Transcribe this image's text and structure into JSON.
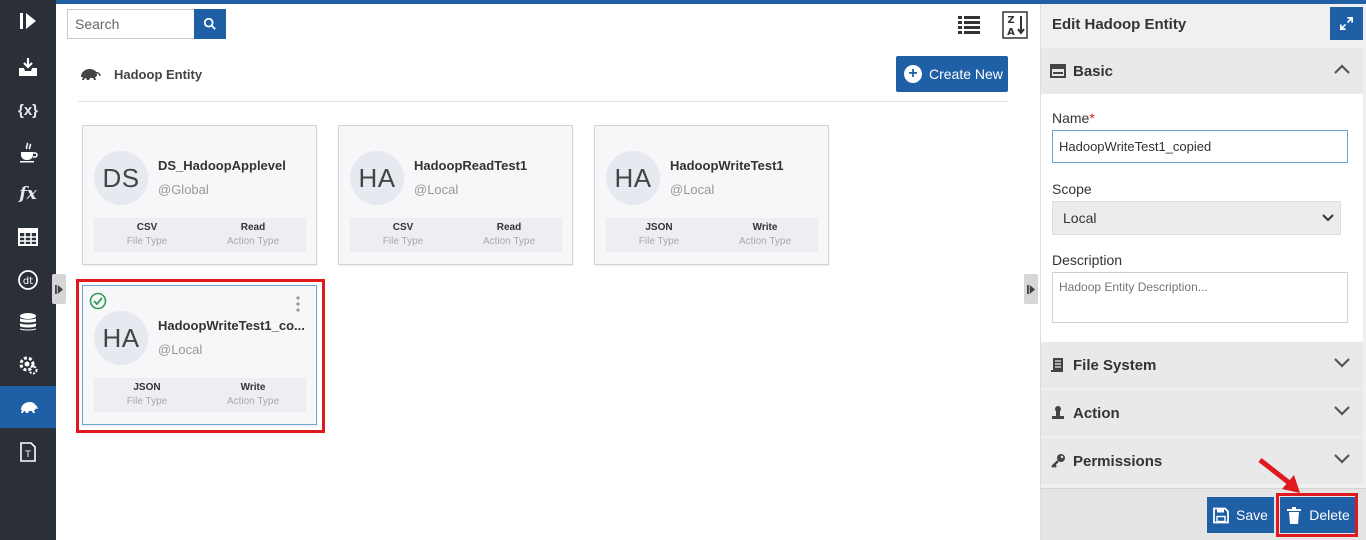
{
  "theme": {
    "accent": "#1f5fa6",
    "rail": "#2b2f38",
    "highlight": "#e0191f"
  },
  "rail": {
    "items": [
      {
        "icon": "play-icon"
      },
      {
        "icon": "download-tray-icon"
      },
      {
        "icon": "variables-icon",
        "text": "{x}"
      },
      {
        "icon": "java-cup-icon"
      },
      {
        "icon": "function-icon",
        "text": "fx"
      },
      {
        "icon": "table-icon"
      },
      {
        "icon": "dt-icon"
      },
      {
        "icon": "database-icon"
      },
      {
        "icon": "gear-settings-icon"
      },
      {
        "icon": "hadoop-elephant-icon",
        "active": true
      },
      {
        "icon": "text-file-icon"
      }
    ]
  },
  "toolbar": {
    "search_placeholder": "Search"
  },
  "page": {
    "title": "Hadoop Entity",
    "create_label": "Create New"
  },
  "cards": [
    {
      "initials": "DS",
      "name": "DS_HadoopApplevel",
      "scope": "@Global",
      "file_type": "CSV",
      "file_type_label": "File Type",
      "action_type": "Read",
      "action_type_label": "Action Type"
    },
    {
      "initials": "HA",
      "name": "HadoopReadTest1",
      "scope": "@Local",
      "file_type": "CSV",
      "file_type_label": "File Type",
      "action_type": "Read",
      "action_type_label": "Action Type"
    },
    {
      "initials": "HA",
      "name": "HadoopWriteTest1",
      "scope": "@Local",
      "file_type": "JSON",
      "file_type_label": "File Type",
      "action_type": "Write",
      "action_type_label": "Action Type"
    },
    {
      "initials": "HA",
      "name": "HadoopWriteTest1_co...",
      "scope": "@Local",
      "file_type": "JSON",
      "file_type_label": "File Type",
      "action_type": "Write",
      "action_type_label": "Action Type",
      "selected": true
    }
  ],
  "panel": {
    "title": "Edit Hadoop Entity",
    "sections": {
      "basic": "Basic",
      "file_system": "File System",
      "action": "Action",
      "permissions": "Permissions"
    },
    "name_label": "Name",
    "required_mark": "*",
    "name_value": "HadoopWriteTest1_copied",
    "scope_label": "Scope",
    "scope_value": "Local",
    "description_label": "Description",
    "description_placeholder": "Hadoop Entity Description...",
    "save_label": "Save",
    "delete_label": "Delete"
  }
}
